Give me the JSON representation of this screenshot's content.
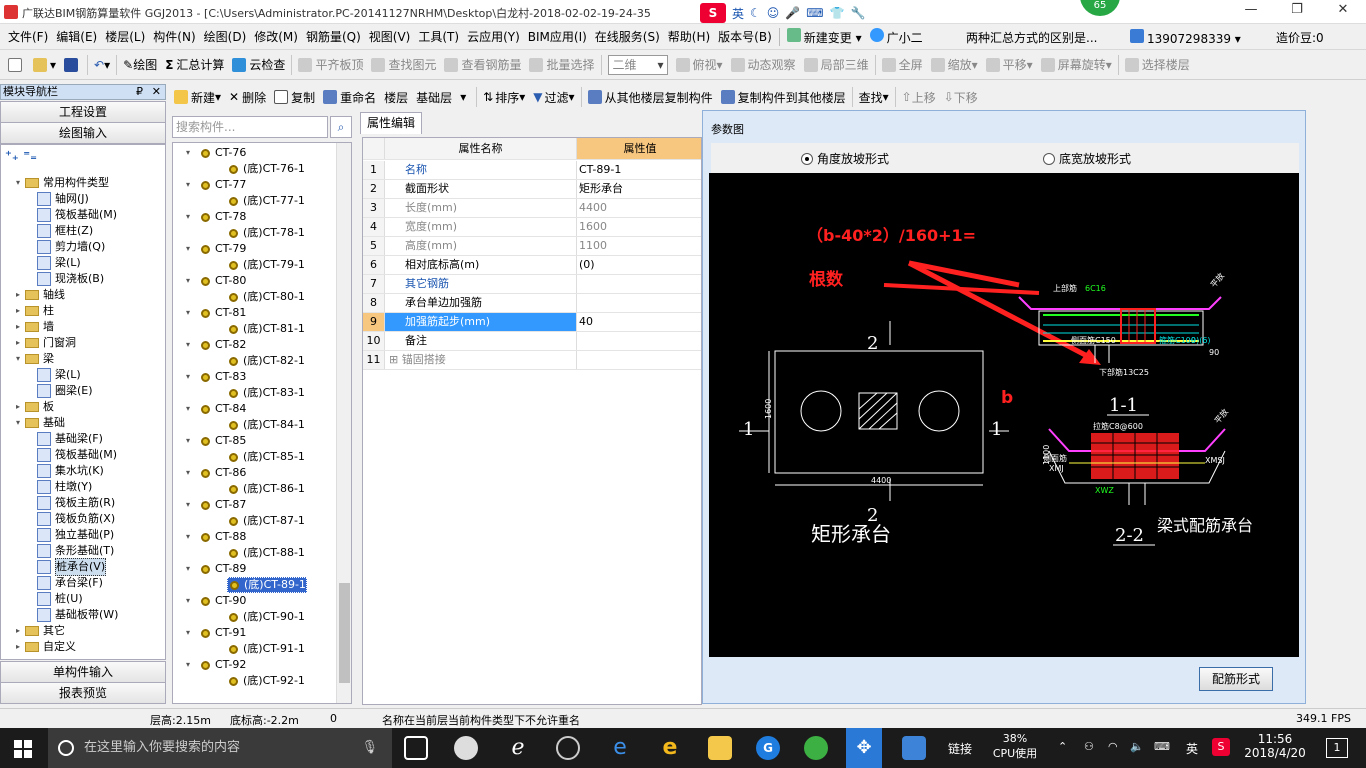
{
  "window": {
    "title": "广联达BIM钢筋算量软件 GGJ2013 - [C:\\Users\\Administrator.PC-20141127NRHM\\Desktop\\白龙村-2018-02-02-19-24-35",
    "badge": "65",
    "ime_label": "英",
    "min": "—",
    "max": "❐",
    "close": "✕"
  },
  "menu": {
    "items": [
      "文件(F)",
      "编辑(E)",
      "楼层(L)",
      "构件(N)",
      "绘图(D)",
      "修改(M)",
      "钢筋量(Q)",
      "视图(V)",
      "工具(T)",
      "云应用(Y)",
      "BIM应用(I)",
      "在线服务(S)",
      "帮助(H)",
      "版本号(B)"
    ],
    "new_change": "新建变更",
    "xiaoer": "广小二",
    "question": "两种汇总方式的区别是...",
    "phone": "13907298339",
    "cost_bean": "造价豆:0"
  },
  "toolbar1": {
    "draw": "绘图",
    "sum": "汇总计算",
    "cloud_check": "云检查",
    "flat_top": "平齐板顶",
    "find_elem": "查找图元",
    "view_rebar": "查看钢筋量",
    "batch_select": "批量选择",
    "view2d": "二维",
    "top_view": "俯视",
    "dynamic": "动态观察",
    "local3d": "局部三维",
    "fullscreen": "全屏",
    "zoom": "缩放",
    "pan": "平移",
    "rotate": "屏幕旋转",
    "select_floor": "选择楼层"
  },
  "toolbar2": {
    "new": "新建",
    "delete": "删除",
    "copy": "复制",
    "rename": "重命名",
    "floor_label": "楼层",
    "floor_value": "基础层",
    "sort": "排序",
    "filter": "过滤",
    "copy_from": "从其他楼层复制构件",
    "copy_to": "复制构件到其他楼层",
    "find": "查找",
    "up": "上移",
    "down": "下移"
  },
  "nav": {
    "header": "模块导航栏",
    "pin": "₽",
    "close": "✕",
    "engineering_settings": "工程设置",
    "drawing_input": "绘图输入",
    "single_input": "单构件输入",
    "report_preview": "报表预览",
    "tree": [
      {
        "label": "常用构件类型",
        "level": 0,
        "type": "folder",
        "exp": "−"
      },
      {
        "label": "轴网(J)",
        "level": 1,
        "type": "comp"
      },
      {
        "label": "筏板基础(M)",
        "level": 1,
        "type": "comp"
      },
      {
        "label": "框柱(Z)",
        "level": 1,
        "type": "comp"
      },
      {
        "label": "剪力墙(Q)",
        "level": 1,
        "type": "comp"
      },
      {
        "label": "梁(L)",
        "level": 1,
        "type": "comp"
      },
      {
        "label": "现浇板(B)",
        "level": 1,
        "type": "comp"
      },
      {
        "label": "轴线",
        "level": 0,
        "type": "folder",
        "exp": "+"
      },
      {
        "label": "柱",
        "level": 0,
        "type": "folder",
        "exp": "+"
      },
      {
        "label": "墙",
        "level": 0,
        "type": "folder",
        "exp": "+"
      },
      {
        "label": "门窗洞",
        "level": 0,
        "type": "folder",
        "exp": "+"
      },
      {
        "label": "梁",
        "level": 0,
        "type": "folder",
        "exp": "−"
      },
      {
        "label": "梁(L)",
        "level": 1,
        "type": "comp"
      },
      {
        "label": "圈梁(E)",
        "level": 1,
        "type": "comp"
      },
      {
        "label": "板",
        "level": 0,
        "type": "folder",
        "exp": "+"
      },
      {
        "label": "基础",
        "level": 0,
        "type": "folder",
        "exp": "−"
      },
      {
        "label": "基础梁(F)",
        "level": 1,
        "type": "comp"
      },
      {
        "label": "筏板基础(M)",
        "level": 1,
        "type": "comp"
      },
      {
        "label": "集水坑(K)",
        "level": 1,
        "type": "comp"
      },
      {
        "label": "柱墩(Y)",
        "level": 1,
        "type": "comp"
      },
      {
        "label": "筏板主筋(R)",
        "level": 1,
        "type": "comp"
      },
      {
        "label": "筏板负筋(X)",
        "level": 1,
        "type": "comp"
      },
      {
        "label": "独立基础(P)",
        "level": 1,
        "type": "comp"
      },
      {
        "label": "条形基础(T)",
        "level": 1,
        "type": "comp"
      },
      {
        "label": "桩承台(V)",
        "level": 1,
        "type": "comp",
        "selected": true
      },
      {
        "label": "承台梁(F)",
        "level": 1,
        "type": "comp"
      },
      {
        "label": "桩(U)",
        "level": 1,
        "type": "comp"
      },
      {
        "label": "基础板带(W)",
        "level": 1,
        "type": "comp"
      },
      {
        "label": "其它",
        "level": 0,
        "type": "folder",
        "exp": "+"
      },
      {
        "label": "自定义",
        "level": 0,
        "type": "folder",
        "exp": "+"
      }
    ]
  },
  "component_list": {
    "search_placeholder": "搜索构件...",
    "search_icon": "search-icon",
    "items": [
      {
        "label": "CT-76",
        "level": 0
      },
      {
        "label": "(底)CT-76-1",
        "level": 1
      },
      {
        "label": "CT-77",
        "level": 0
      },
      {
        "label": "(底)CT-77-1",
        "level": 1
      },
      {
        "label": "CT-78",
        "level": 0
      },
      {
        "label": "(底)CT-78-1",
        "level": 1
      },
      {
        "label": "CT-79",
        "level": 0
      },
      {
        "label": "(底)CT-79-1",
        "level": 1
      },
      {
        "label": "CT-80",
        "level": 0
      },
      {
        "label": "(底)CT-80-1",
        "level": 1
      },
      {
        "label": "CT-81",
        "level": 0
      },
      {
        "label": "(底)CT-81-1",
        "level": 1
      },
      {
        "label": "CT-82",
        "level": 0
      },
      {
        "label": "(底)CT-82-1",
        "level": 1
      },
      {
        "label": "CT-83",
        "level": 0
      },
      {
        "label": "(底)CT-83-1",
        "level": 1
      },
      {
        "label": "CT-84",
        "level": 0
      },
      {
        "label": "(底)CT-84-1",
        "level": 1
      },
      {
        "label": "CT-85",
        "level": 0
      },
      {
        "label": "(底)CT-85-1",
        "level": 1
      },
      {
        "label": "CT-86",
        "level": 0
      },
      {
        "label": "(底)CT-86-1",
        "level": 1
      },
      {
        "label": "CT-87",
        "level": 0
      },
      {
        "label": "(底)CT-87-1",
        "level": 1
      },
      {
        "label": "CT-88",
        "level": 0
      },
      {
        "label": "(底)CT-88-1",
        "level": 1
      },
      {
        "label": "CT-89",
        "level": 0
      },
      {
        "label": "(底)CT-89-1",
        "level": 1,
        "selected": true
      },
      {
        "label": "CT-90",
        "level": 0
      },
      {
        "label": "(底)CT-90-1",
        "level": 1
      },
      {
        "label": "CT-91",
        "level": 0
      },
      {
        "label": "(底)CT-91-1",
        "level": 1
      },
      {
        "label": "CT-92",
        "level": 0
      },
      {
        "label": "(底)CT-92-1",
        "level": 1
      }
    ]
  },
  "props": {
    "tab": "属性编辑",
    "col_name": "属性名称",
    "col_value": "属性值",
    "rows": [
      {
        "no": "1",
        "name": "名称",
        "value": "CT-89-1",
        "style": "blue"
      },
      {
        "no": "2",
        "name": "截面形状",
        "value": "矩形承台",
        "style": ""
      },
      {
        "no": "3",
        "name": "长度(mm)",
        "value": "4400",
        "style": "gray"
      },
      {
        "no": "4",
        "name": "宽度(mm)",
        "value": "1600",
        "style": "gray"
      },
      {
        "no": "5",
        "name": "高度(mm)",
        "value": "1100",
        "style": "gray"
      },
      {
        "no": "6",
        "name": "相对底标高(m)",
        "value": "(0)",
        "style": ""
      },
      {
        "no": "7",
        "name": "其它钢筋",
        "value": "",
        "style": "blue"
      },
      {
        "no": "8",
        "name": "承台单边加强筋",
        "value": "",
        "style": ""
      },
      {
        "no": "9",
        "name": "加强筋起步(mm)",
        "value": "40",
        "style": "sel"
      },
      {
        "no": "10",
        "name": "备注",
        "value": "",
        "style": ""
      },
      {
        "no": "11",
        "name": "锚固搭接",
        "value": "",
        "style": "gray",
        "expand": "+"
      }
    ]
  },
  "dialog": {
    "title": "参数图",
    "radio1": "角度放坡形式",
    "radio2": "底宽放坡形式",
    "button": "配筋形式",
    "cad": {
      "formula": "（b-40*2）/160+1=",
      "roots": "根数",
      "b_label": "b",
      "sec2_top": "2",
      "sec2_bottom": "2",
      "sec1_left": "1",
      "sec1_right": "1",
      "dim_w": "4400",
      "dim_h": "1600",
      "caption_rect": "矩形承台",
      "caption_beam": "梁式配筋承台",
      "section11": "1-1",
      "section22": "2-2",
      "top_bar": "上部筋",
      "top_bar_val": "6C16",
      "side_bar": "侧面筋C150",
      "bot_bar": "下部筋13C25",
      "hoop": "箍筋C100",
      "leg": "9)(6)",
      "ang": "90",
      "slope": "平放",
      "tie": "拉筋C8@600",
      "side2": "侧面筋",
      "xmj": "XMJ",
      "xmsj": "XMSJ",
      "xwz": "XWZ",
      "h1100": "1100"
    }
  },
  "status": {
    "floor_h": "层高:2.15m",
    "bottom_elev": "底标高:-2.2m",
    "zero": "0",
    "message": "名称在当前层当前构件类型下不允许重名",
    "fps": "349.1 FPS"
  },
  "taskbar": {
    "search": "在这里输入你要搜索的内容",
    "link": "链接",
    "cpu_pct": "38%",
    "cpu_label": "CPU使用",
    "lang": "英",
    "time": "11:56",
    "date": "2018/4/20",
    "notif": "1"
  }
}
